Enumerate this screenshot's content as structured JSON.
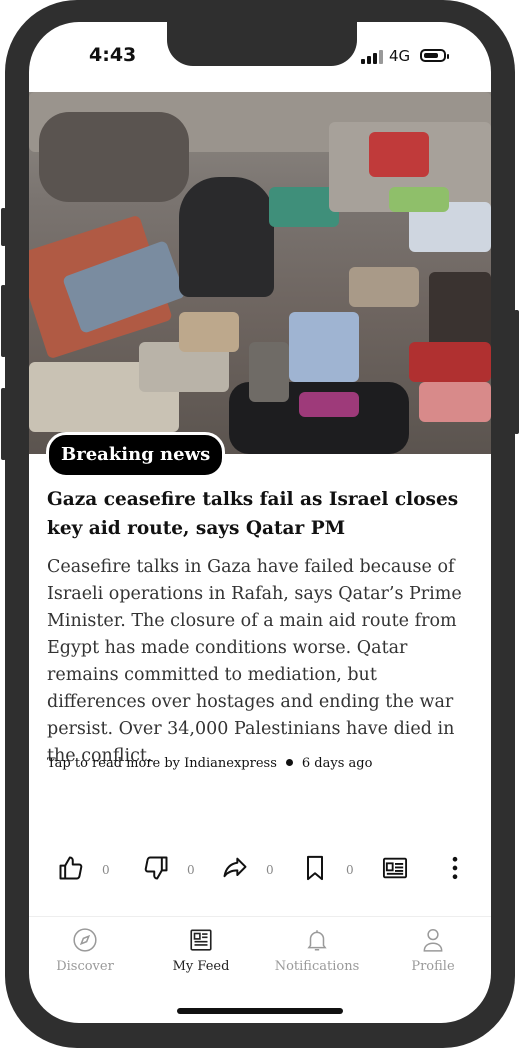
{
  "status": {
    "time": "4:43",
    "network": "4G"
  },
  "article": {
    "badge": "Breaking news",
    "headline": "Gaza ceasefire talks fail as Israel closes key aid route, says Qatar PM",
    "summary": "Ceasefire talks in Gaza have failed because of Israeli operations in Rafah, says Qatar’s Prime Minister. The closure of a main aid route from Egypt has made conditions worse. Qatar remains committed to mediation, but differences over hostages and ending the war persist. Over 34,000 Palestinians have died in the conflict.",
    "source_text": "Tap to read more by Indianexpress",
    "age": "6 days ago"
  },
  "actions": {
    "like_count": "0",
    "dislike_count": "0",
    "share_count": "0",
    "bookmark_count": "0"
  },
  "tabs": [
    {
      "label": "Discover",
      "icon": "compass-icon"
    },
    {
      "label": "My Feed",
      "icon": "newspaper-icon"
    },
    {
      "label": "Notifications",
      "icon": "bell-icon"
    },
    {
      "label": "Profile",
      "icon": "person-icon"
    }
  ],
  "colors": {
    "badge_bg": "#000000",
    "active_tab": "#222222",
    "inactive_tab": "#9a9a9a"
  }
}
